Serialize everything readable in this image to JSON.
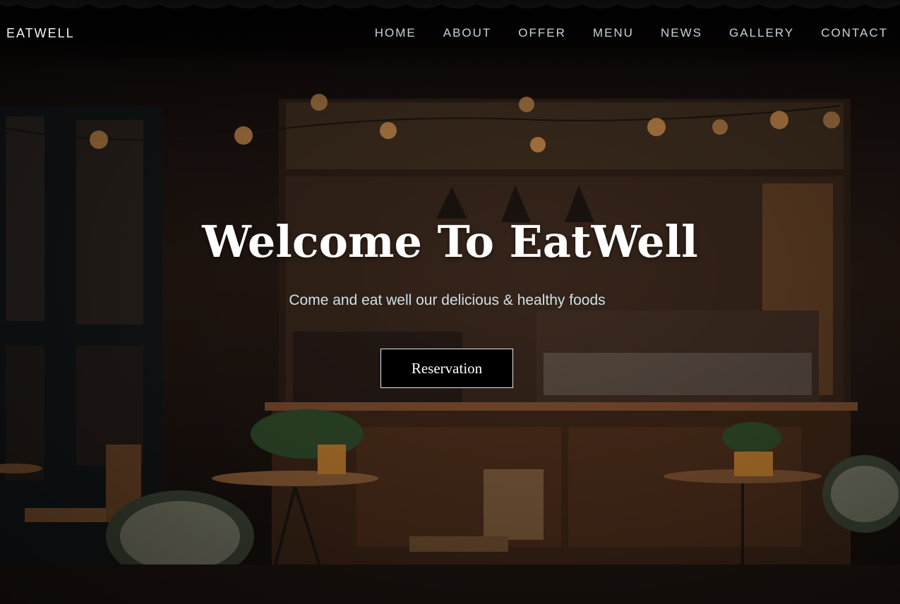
{
  "brand": {
    "name": "EATWELL"
  },
  "nav": {
    "items": [
      {
        "label": "HOME"
      },
      {
        "label": "ABOUT"
      },
      {
        "label": "OFFER"
      },
      {
        "label": "MENU"
      },
      {
        "label": "NEWS"
      },
      {
        "label": "GALLERY"
      },
      {
        "label": "CONTACT"
      }
    ]
  },
  "hero": {
    "title": "Welcome To EatWell",
    "subtitle": "Come and eat well our delicious & healthy foods",
    "cta_label": "Reservation"
  },
  "colors": {
    "button_background": "#000000",
    "button_border": "#e6e6e6",
    "nav_text": "#c9d3d6",
    "subtitle_text": "#cfe0e6"
  }
}
